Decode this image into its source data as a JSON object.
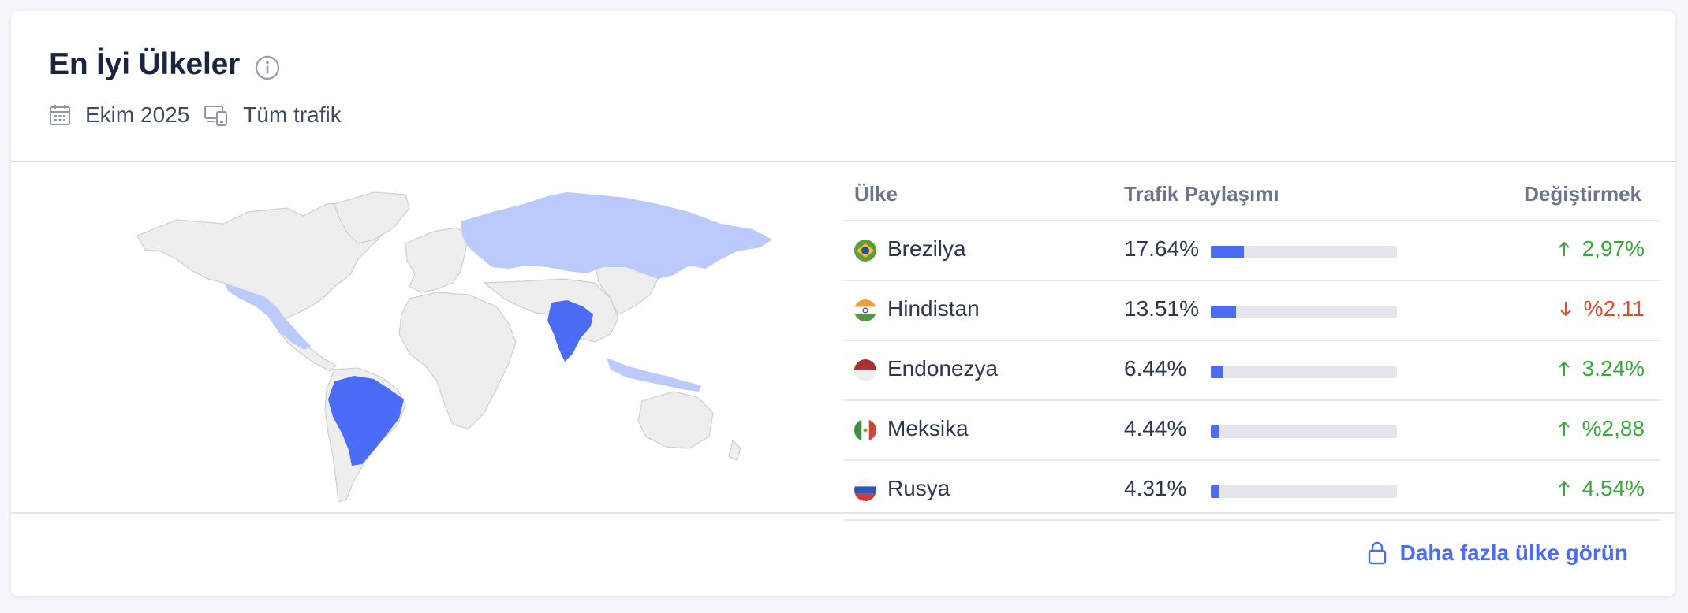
{
  "header": {
    "title": "En İyi Ülkeler",
    "date": "Ekim 2025",
    "traffic": "Tüm trafik"
  },
  "table": {
    "columns": {
      "country": "Ülke",
      "share": "Trafik Paylaşımı",
      "change": "Değiştirmek"
    },
    "rows": [
      {
        "country": "Brezilya",
        "share": "17.64%",
        "share_value": 17.64,
        "change": "2,97%",
        "direction": "up",
        "flag": "brazil-flag"
      },
      {
        "country": "Hindistan",
        "share": "13.51%",
        "share_value": 13.51,
        "change": "%2,11",
        "direction": "down",
        "flag": "india-flag"
      },
      {
        "country": "Endonezya",
        "share": "6.44%",
        "share_value": 6.44,
        "change": "3.24%",
        "direction": "up",
        "flag": "indonesia-flag"
      },
      {
        "country": "Meksika",
        "share": "4.44%",
        "share_value": 4.44,
        "change": "%2,88",
        "direction": "up",
        "flag": "mexico-flag"
      },
      {
        "country": "Rusya",
        "share": "4.31%",
        "share_value": 4.31,
        "change": "4.54%",
        "direction": "up",
        "flag": "russia-flag"
      }
    ]
  },
  "footer": {
    "more_label": "Daha fazla ülke görün"
  },
  "colors": {
    "accent": "#4a6cf7",
    "highlight_light": "#bccafb",
    "up": "#3aa83a",
    "down": "#e04b2e",
    "map_base": "#eeeeee"
  }
}
